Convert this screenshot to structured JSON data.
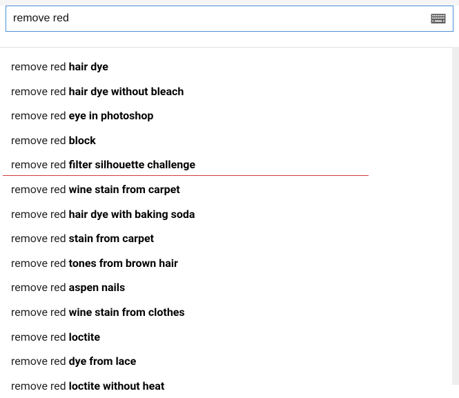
{
  "search": {
    "value": "remove red"
  },
  "suggestions": [
    {
      "prefix": "remove red ",
      "completion": "hair dye"
    },
    {
      "prefix": "remove red ",
      "completion": "hair dye without bleach"
    },
    {
      "prefix": "remove red ",
      "completion": "eye in photoshop"
    },
    {
      "prefix": "remove red ",
      "completion": "block"
    },
    {
      "prefix": "remove red ",
      "completion": "filter silhouette challenge"
    },
    {
      "prefix": "remove red ",
      "completion": "wine stain from carpet"
    },
    {
      "prefix": "remove red ",
      "completion": "hair dye with baking soda"
    },
    {
      "prefix": "remove red ",
      "completion": "stain from carpet"
    },
    {
      "prefix": "remove red ",
      "completion": "tones from brown hair"
    },
    {
      "prefix": "remove red ",
      "completion": "aspen nails"
    },
    {
      "prefix": "remove red ",
      "completion": "wine stain from clothes"
    },
    {
      "prefix": "remove red ",
      "completion": "loctite"
    },
    {
      "prefix": "remove red ",
      "completion": "dye from lace"
    },
    {
      "prefix": "remove red ",
      "completion": "loctite without heat"
    }
  ],
  "highlighted_index": 4
}
